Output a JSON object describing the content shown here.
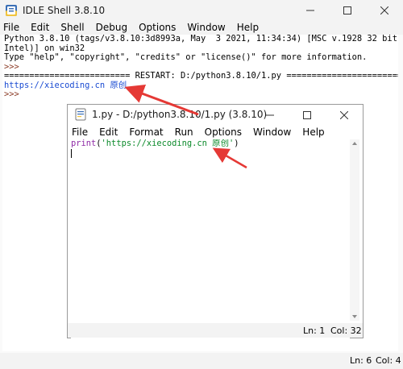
{
  "shell": {
    "title": "IDLE Shell 3.8.10",
    "menu": [
      "File",
      "Edit",
      "Shell",
      "Debug",
      "Options",
      "Window",
      "Help"
    ],
    "lines": {
      "banner1": "Python 3.8.10 (tags/v3.8.10:3d8993a, May  3 2021, 11:34:34) [MSC v.1928 32 bit (",
      "banner2": "Intel)] on win32",
      "banner3": "Type \"help\", \"copyright\", \"credits\" or \"license()\" for more information.",
      "prompt1": ">>> ",
      "restart": "========================= RESTART: D:/python3.8.10/1.py ========================",
      "output": "https://xiecoding.cn 原创",
      "prompt2": ">>> "
    },
    "status": {
      "line": "Ln: 6",
      "col": "Col: 4"
    }
  },
  "editor": {
    "title": "1.py - D:/python3.8.10/1.py (3.8.10)",
    "menu": [
      "File",
      "Edit",
      "Format",
      "Run",
      "Options",
      "Window",
      "Help"
    ],
    "code": {
      "builtin": "print",
      "open": "(",
      "string": "'https://xiecoding.cn 原创'",
      "close": ")"
    },
    "status": {
      "line": "Ln: 1",
      "col": "Col: 32"
    }
  },
  "colors": {
    "url_output": "#1a4bd2",
    "prompt": "#8b3b26",
    "builtin": "#8f2ba6",
    "string": "#0b8a2a",
    "annotation_arrow": "#e53935"
  },
  "icons": [
    "python-idle-icon",
    "minimize-icon",
    "maximize-icon",
    "close-icon"
  ]
}
